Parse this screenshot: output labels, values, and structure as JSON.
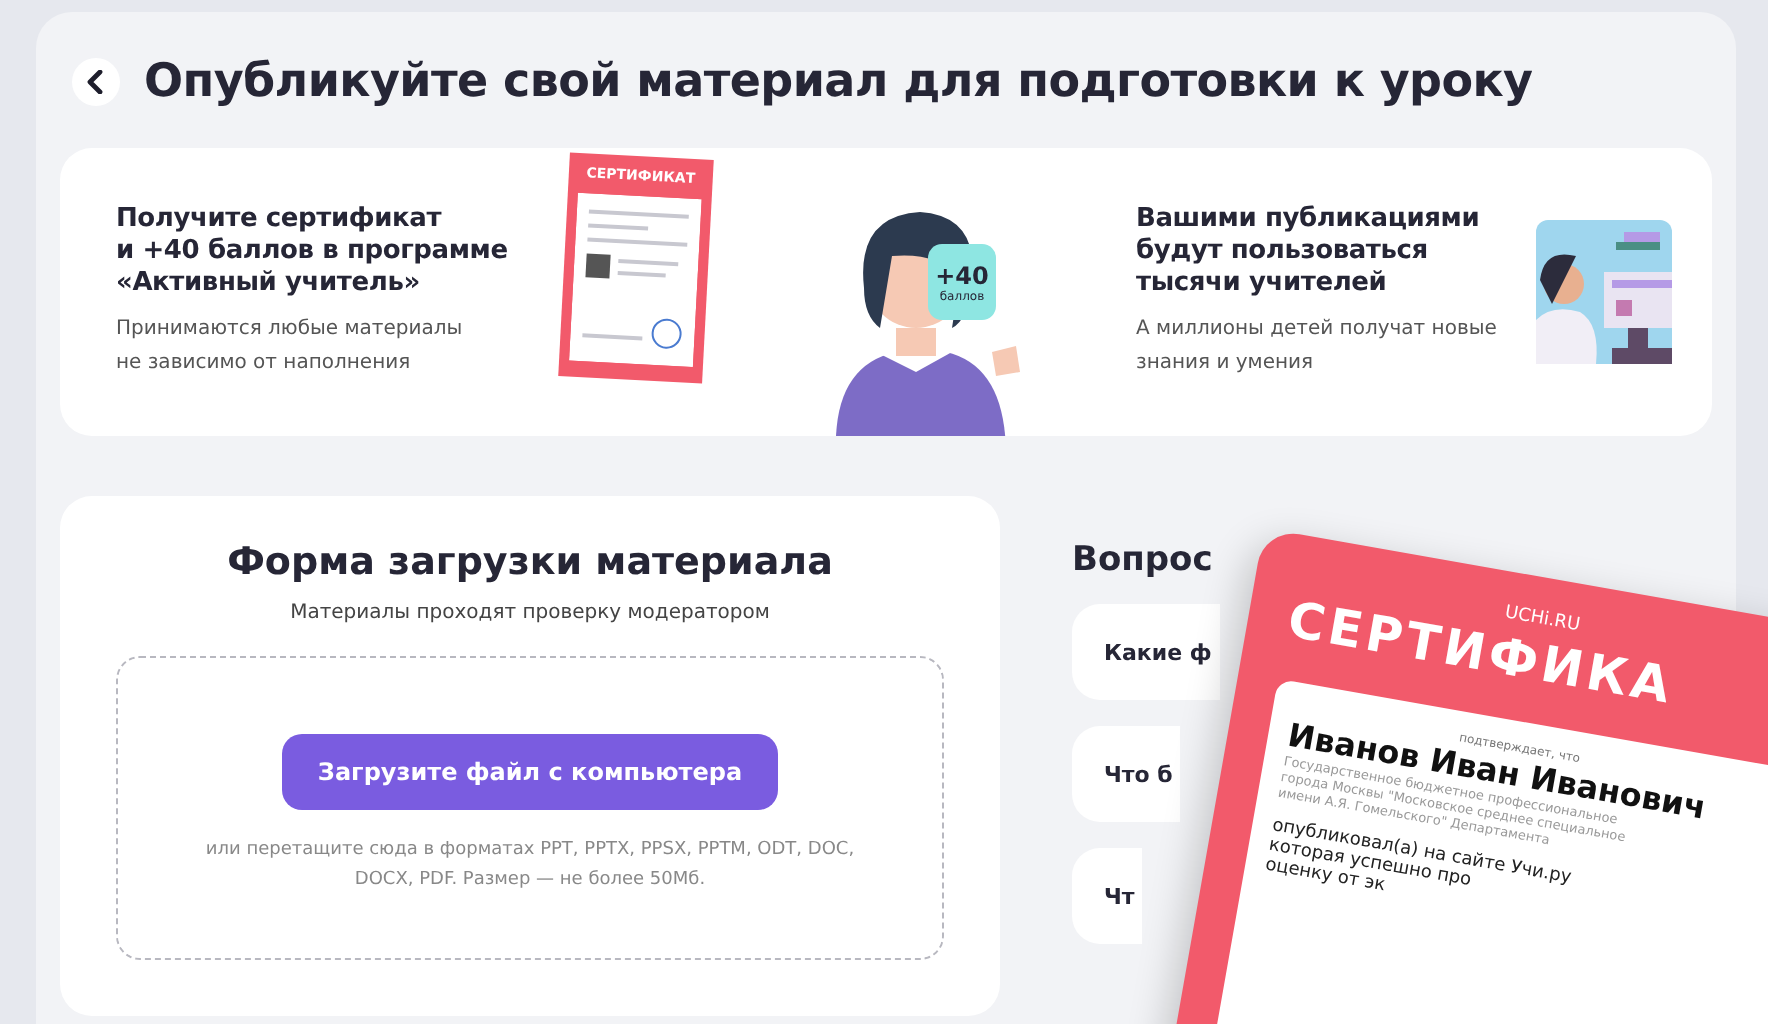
{
  "header": {
    "title": "Опубликуйте свой материал для подготовки к уроку"
  },
  "promo": {
    "left": {
      "title": "Получите сертификат\nи +40 баллов в программе\n«Активный учитель»",
      "description": "Принимаются любые материалы\nне зависимо от наполнения",
      "illustration": {
        "certificate_title": "СЕРТИФИКАТ",
        "badge_value": "+40",
        "badge_unit": "баллов"
      }
    },
    "right": {
      "title": "Вашими публикациями\nбудут пользоваться\nтысячи учителей",
      "description": "А миллионы детей получат новые\nзнания и умения"
    }
  },
  "upload_form": {
    "title": "Форма загрузки материала",
    "subtitle": "Материалы проходят проверку модератором",
    "button": "Загрузите файл с компьютера",
    "hint": "или перетащите сюда в форматах PPT, PPTX, PPSX, PPTM, ODT, DOC,\nDOCX, PDF. Размер — не более 50Мб."
  },
  "questions": {
    "title": "Вопрос",
    "items": [
      "Какие ф",
      "Что б",
      "Чт"
    ]
  },
  "certificate_overlay": {
    "brand": "UCHi.RU",
    "title": "СЕРТИФИКА",
    "caption": "подтверждает, что",
    "name": "Иванов Иван Иванович",
    "org_lines": [
      "Государственное бюджетное профессиональное",
      "города Москвы \"Московское среднее специальное",
      "имени А.Я. Гомельского\" Департамента"
    ],
    "body_lines": [
      "опубликовал(а) на сайте Учи.ру",
      "которая успешно про",
      "оценку от эк"
    ]
  }
}
